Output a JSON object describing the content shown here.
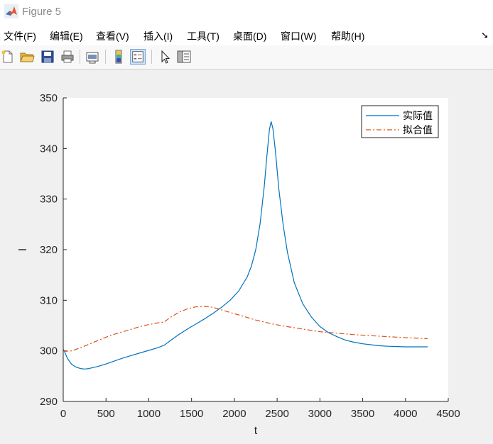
{
  "window": {
    "title": "Figure 5",
    "icon": "matlab-icon"
  },
  "menu": {
    "items": [
      "文件(F)",
      "编辑(E)",
      "查看(V)",
      "插入(I)",
      "工具(T)",
      "桌面(D)",
      "窗口(W)",
      "帮助(H)"
    ],
    "overflow_icon": "arrow-icon"
  },
  "toolbar": {
    "buttons": [
      "new-figure-icon",
      "open-file-icon",
      "save-icon",
      "print-icon",
      "link-plot-icon",
      "colorbar-icon",
      "legend-icon",
      "pointer-icon",
      "property-inspector-icon"
    ]
  },
  "chart_data": {
    "type": "line",
    "xlabel": "t",
    "ylabel": "I",
    "xlim": [
      0,
      4500
    ],
    "ylim": [
      290,
      350
    ],
    "xticks": [
      0,
      500,
      1000,
      1500,
      2000,
      2500,
      3000,
      3500,
      4000,
      4500
    ],
    "yticks": [
      290,
      300,
      310,
      320,
      330,
      340,
      350
    ],
    "grid": false,
    "legend_position": "top-right",
    "series": [
      {
        "name": "实际值",
        "color": "#0072bd",
        "style": "solid",
        "x": [
          0,
          50,
          100,
          150,
          200,
          250,
          300,
          400,
          500,
          600,
          700,
          800,
          900,
          1000,
          1100,
          1180,
          1250,
          1350,
          1450,
          1550,
          1650,
          1750,
          1850,
          1950,
          2050,
          2150,
          2200,
          2250,
          2300,
          2350,
          2380,
          2410,
          2430,
          2450,
          2480,
          2520,
          2570,
          2620,
          2700,
          2800,
          2900,
          3000,
          3100,
          3200,
          3300,
          3400,
          3500,
          3600,
          3700,
          3800,
          3900,
          4000,
          4100,
          4200,
          4260
        ],
        "values": [
          300.4,
          298.5,
          297.3,
          296.8,
          296.5,
          296.4,
          296.5,
          296.9,
          297.4,
          298.0,
          298.6,
          299.1,
          299.6,
          300.1,
          300.6,
          301.1,
          302.0,
          303.2,
          304.3,
          305.3,
          306.3,
          307.4,
          308.6,
          310.0,
          311.8,
          314.6,
          316.8,
          320.0,
          325.0,
          332.5,
          338.5,
          343.8,
          345.3,
          344.0,
          339.5,
          332.0,
          325.0,
          319.5,
          313.5,
          309.3,
          306.7,
          304.8,
          303.6,
          302.8,
          302.1,
          301.7,
          301.4,
          301.2,
          301.0,
          300.9,
          300.85,
          300.8,
          300.8,
          300.8,
          300.8
        ]
      },
      {
        "name": "拟合值",
        "color": "#d95319",
        "style": "dashdot",
        "x": [
          0,
          100,
          200,
          300,
          400,
          500,
          600,
          700,
          800,
          900,
          1000,
          1100,
          1180,
          1250,
          1350,
          1450,
          1550,
          1650,
          1750,
          1850,
          1950,
          2050,
          2150,
          2250,
          2350,
          2450,
          2550,
          2650,
          2800,
          3000,
          3200,
          3400,
          3600,
          3800,
          4000,
          4260
        ],
        "values": [
          299.9,
          300.0,
          300.6,
          301.3,
          302.0,
          302.7,
          303.3,
          303.8,
          304.3,
          304.8,
          305.2,
          305.5,
          305.7,
          306.6,
          307.6,
          308.3,
          308.7,
          308.8,
          308.6,
          308.1,
          307.6,
          307.1,
          306.6,
          306.1,
          305.7,
          305.3,
          305.0,
          304.7,
          304.3,
          303.8,
          303.5,
          303.2,
          303.0,
          302.8,
          302.6,
          302.4
        ]
      }
    ]
  }
}
